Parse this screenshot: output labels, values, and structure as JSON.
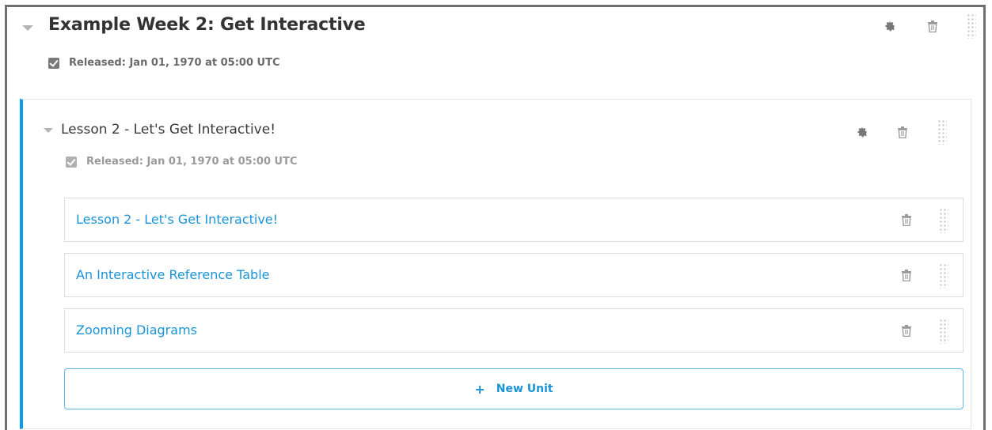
{
  "section": {
    "title": "Example Week 2: Get Interactive",
    "released": "Released: Jan 01, 1970 at 05:00 UTC"
  },
  "subsection": {
    "title": "Lesson 2 - Let's Get Interactive!",
    "released": "Released: Jan 01, 1970 at 05:00 UTC"
  },
  "units": [
    {
      "label": "Lesson 2 - Let's Get Interactive!"
    },
    {
      "label": "An Interactive Reference Table"
    },
    {
      "label": "Zooming Diagrams"
    }
  ],
  "new_unit": {
    "plus": "+",
    "label": "New Unit"
  },
  "colors": {
    "accent": "#0a9ded",
    "link": "#1a94d8",
    "frame_border": "#6f6f6f",
    "icon_gray": "#9a9a9a"
  },
  "icons": [
    "collapse-arrow-icon",
    "checkbox-icon",
    "gear-icon",
    "trash-icon",
    "drag-handle-icon",
    "plus-icon"
  ]
}
